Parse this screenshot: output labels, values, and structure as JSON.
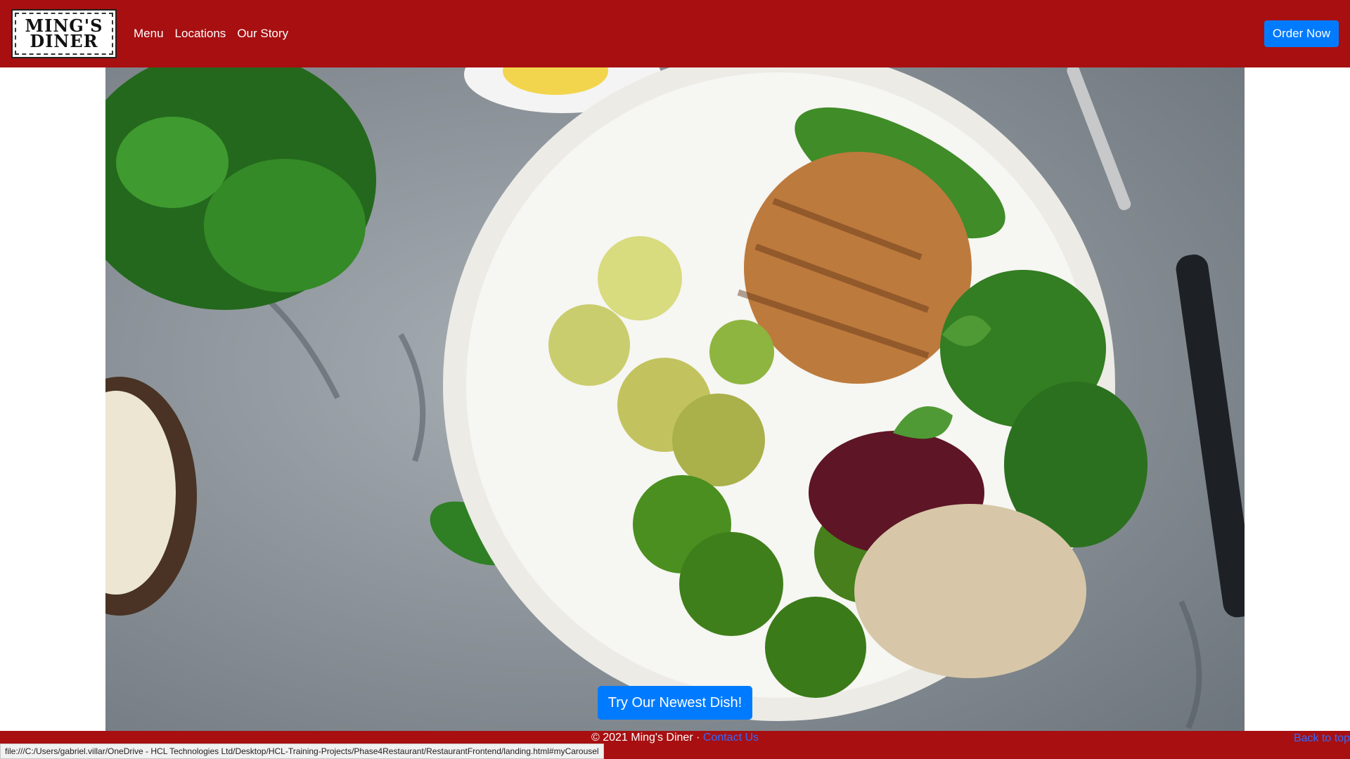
{
  "brand": {
    "line1": "MING'S",
    "line2": "DINER"
  },
  "nav": {
    "items": [
      "Menu",
      "Locations",
      "Our Story"
    ],
    "order_label": "Order Now"
  },
  "hero": {
    "cta_label": "Try Our Newest Dish!"
  },
  "footer": {
    "copyright": "© 2021 Ming's Diner · ",
    "contact": "Contact Us",
    "back_to_top": "Back to top"
  },
  "status": {
    "url": "file:///C:/Users/gabriel.villar/OneDrive - HCL Technologies Ltd/Desktop/HCL-Training-Projects/Phase4Restaurant/RestaurantFrontend/landing.html#myCarousel"
  }
}
